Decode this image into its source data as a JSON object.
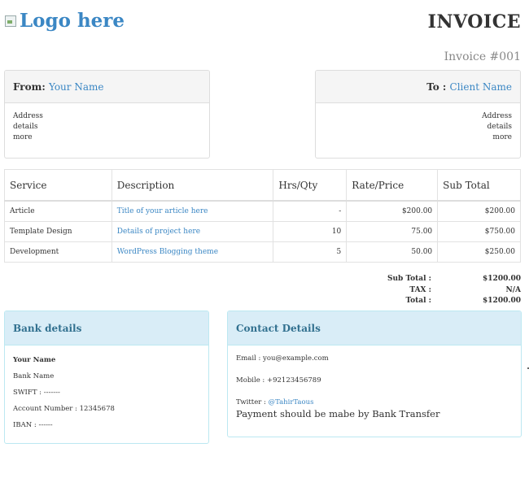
{
  "header": {
    "logo_text": "Logo here",
    "title": "INVOICE",
    "invoice_number": "Invoice #001"
  },
  "from": {
    "label": "From: ",
    "name": "Your Name",
    "address": [
      "Address",
      "details",
      "more"
    ]
  },
  "to": {
    "label": "To : ",
    "name": "Client Name",
    "address": [
      "Address",
      "details",
      "more"
    ]
  },
  "table": {
    "columns": [
      "Service",
      "Description",
      "Hrs/Qty",
      "Rate/Price",
      "Sub Total"
    ],
    "rows": [
      [
        "Article",
        "Title of your article here",
        "-",
        "$200.00",
        "$200.00"
      ],
      [
        "Template Design",
        "Details of project here",
        "10",
        "75.00",
        "$750.00"
      ],
      [
        "Development",
        "WordPress Blogging theme",
        "5",
        "50.00",
        "$250.00"
      ]
    ]
  },
  "totals": [
    {
      "label": "Sub Total :",
      "value": "$1200.00"
    },
    {
      "label": "TAX :",
      "value": "N/A"
    },
    {
      "label": "Total :",
      "value": "$1200.00"
    }
  ],
  "bank": {
    "title": "Bank details",
    "lines": [
      "Your Name",
      "Bank Name",
      "SWIFT : -------",
      "Account Number : 12345678",
      "IBAN : ------"
    ]
  },
  "contact": {
    "title": "Contact Details",
    "email": "Email : you@example.com",
    "mobile": "Mobile : +92123456789",
    "twitter_label": "Twitter : ",
    "twitter_handle": "@TahirTaous",
    "note": "Payment should be mabe by Bank Transfer"
  },
  "colors": {
    "link": "#3b87c4",
    "info_bg": "#d9edf7",
    "info_text": "#31708f"
  }
}
